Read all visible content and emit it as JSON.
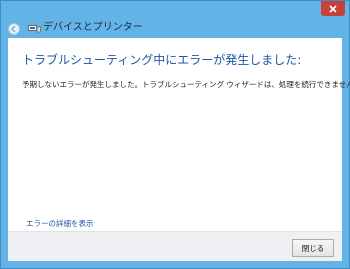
{
  "window": {
    "title": "デバイスとプリンター",
    "close_symbol": "✕"
  },
  "content": {
    "heading": "トラブルシューティング中にエラーが発生しました:",
    "message": "予期しないエラーが発生しました。トラブルシューティング ウィザードは、処理を続行できません。",
    "details_link": "エラーの詳細を表示"
  },
  "footer": {
    "close_button": "閉じる"
  },
  "icons": {
    "back": "back-arrow-icon",
    "title": "devices-printers-icon",
    "close": "close-icon"
  },
  "colors": {
    "frame": "#63b3e6",
    "close_button": "#c7413a",
    "heading": "#1f55a6",
    "link": "#1f55a6"
  }
}
